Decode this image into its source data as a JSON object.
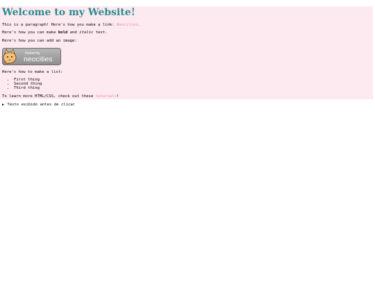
{
  "page": {
    "heading": "Welcome to my Website!",
    "para1": {
      "before": "This is a paragraph! Here's how you make a link: ",
      "link": "Neocities",
      "after": "."
    },
    "para2": {
      "before": "Here's how you can make ",
      "bold": "bold",
      "middle": " and ",
      "italic": "italic",
      "after": " text."
    },
    "para3": "Here's how you can add an image:",
    "image": {
      "alt": "Site hosted by Neocities",
      "line1": "hosted by",
      "line2": "neocities"
    },
    "para4": "Here's how to make a list:",
    "list": [
      "First thing",
      "Second thing",
      "Third thing"
    ],
    "para5": {
      "before": "To learn more HTML/CSS, check out these ",
      "link": "tutorials",
      "after": "!"
    },
    "details_summary": "Texto exibido antes de clicar",
    "details_marker": "▶"
  },
  "colors": {
    "background": "#fde9f0",
    "heading": "#2b8a8d",
    "link": "#f08aa8"
  },
  "icons": {
    "details_marker": "disclosure-triangle-icon",
    "badge_mascot": "neocities-cat-icon"
  }
}
